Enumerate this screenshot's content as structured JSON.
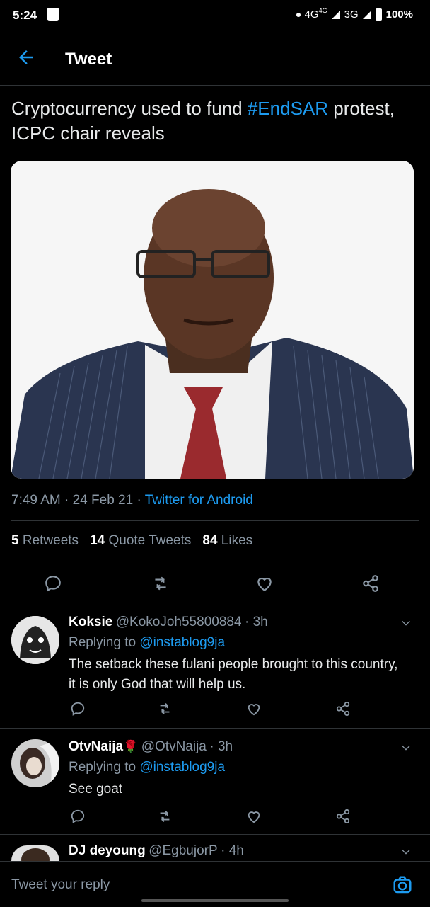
{
  "status_bar": {
    "time": "5:24",
    "network": "4G",
    "network_small": "4G",
    "network2": "3G",
    "battery": "100%"
  },
  "header": {
    "title": "Tweet"
  },
  "tweet": {
    "text_before": "Cryptocurrency used to fund ",
    "hashtag": "#EndSAR",
    "text_after": " protest, ICPC chair reveals",
    "time": "7:49 AM",
    "date": "24 Feb 21",
    "source": "Twitter for Android",
    "stats": {
      "retweets_count": "5",
      "retweets_label": "Retweets",
      "quotes_count": "14",
      "quotes_label": "Quote Tweets",
      "likes_count": "84",
      "likes_label": "Likes"
    }
  },
  "replies": [
    {
      "name": "Koksie",
      "handle": "@KokoJoh55800884",
      "age": "3h",
      "replying_label": "Replying to",
      "replying_to": "@instablog9ja",
      "text": "The setback these fulani people brought to this country, it is only God that will help us."
    },
    {
      "name": "OtvNaija",
      "emoji": "🌹",
      "handle": "@OtvNaija",
      "age": "3h",
      "replying_label": "Replying to",
      "replying_to": "@instablog9ja",
      "text": "See goat"
    },
    {
      "name": "DJ deyoung",
      "handle": "@EgbujorP",
      "age": "4h"
    }
  ],
  "composer": {
    "placeholder": "Tweet your reply"
  },
  "icons": [
    "back-arrow-icon",
    "reply-icon",
    "retweet-icon",
    "like-icon",
    "share-icon",
    "chevron-down-icon",
    "camera-icon"
  ],
  "colors": {
    "accent": "#1d9bf0",
    "muted": "#8b98a5",
    "background": "#000000"
  }
}
